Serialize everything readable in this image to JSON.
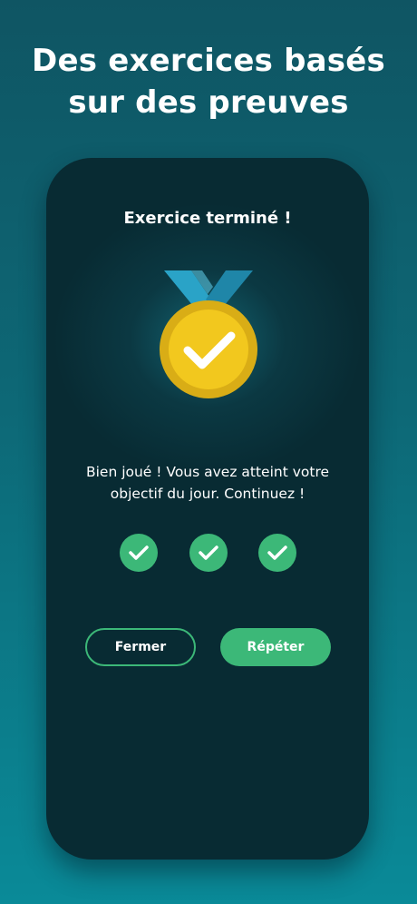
{
  "header": {
    "line1": "Des exercices basés",
    "line2": "sur des preuves"
  },
  "screen": {
    "title": "Exercice terminé !",
    "medal_icon": "medal-check-icon",
    "message_line1": "Bien joué ! Vous avez atteint votre",
    "message_line2": "objectif du jour. Continuez !",
    "completed_checks": 3,
    "check_icon": "check-circle-icon"
  },
  "buttons": {
    "close_label": "Fermer",
    "repeat_label": "Répéter"
  },
  "colors": {
    "accent_green": "#3cb878",
    "medal_gold": "#f2c81e",
    "ribbon_blue": "#2aa3c7",
    "phone_bg": "#082b33",
    "background_top": "#0f5563",
    "background_bottom": "#0a8a98"
  }
}
